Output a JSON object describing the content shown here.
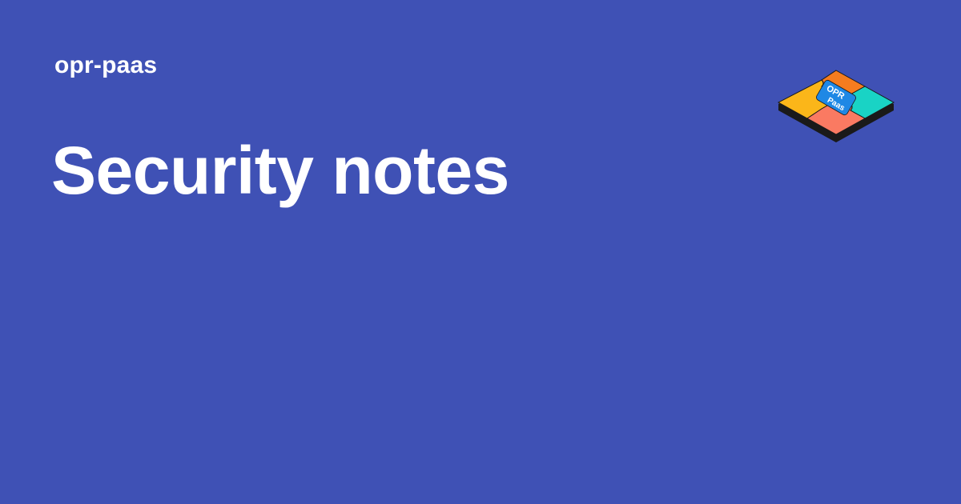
{
  "header": {
    "site_name": "opr-paas"
  },
  "main": {
    "title": "Security notes"
  },
  "logo": {
    "icon": "puzzle-logo-icon",
    "text_line1": "OPR",
    "text_line2": "Paas",
    "colors": {
      "orange": "#f57c1f",
      "teal": "#19d3c5",
      "yellow": "#fbb619",
      "coral": "#fa7a62",
      "center": "#1e88e5",
      "edge": "#1a1a1a"
    }
  },
  "theme": {
    "background": "#3f51b5",
    "text": "#ffffff"
  }
}
